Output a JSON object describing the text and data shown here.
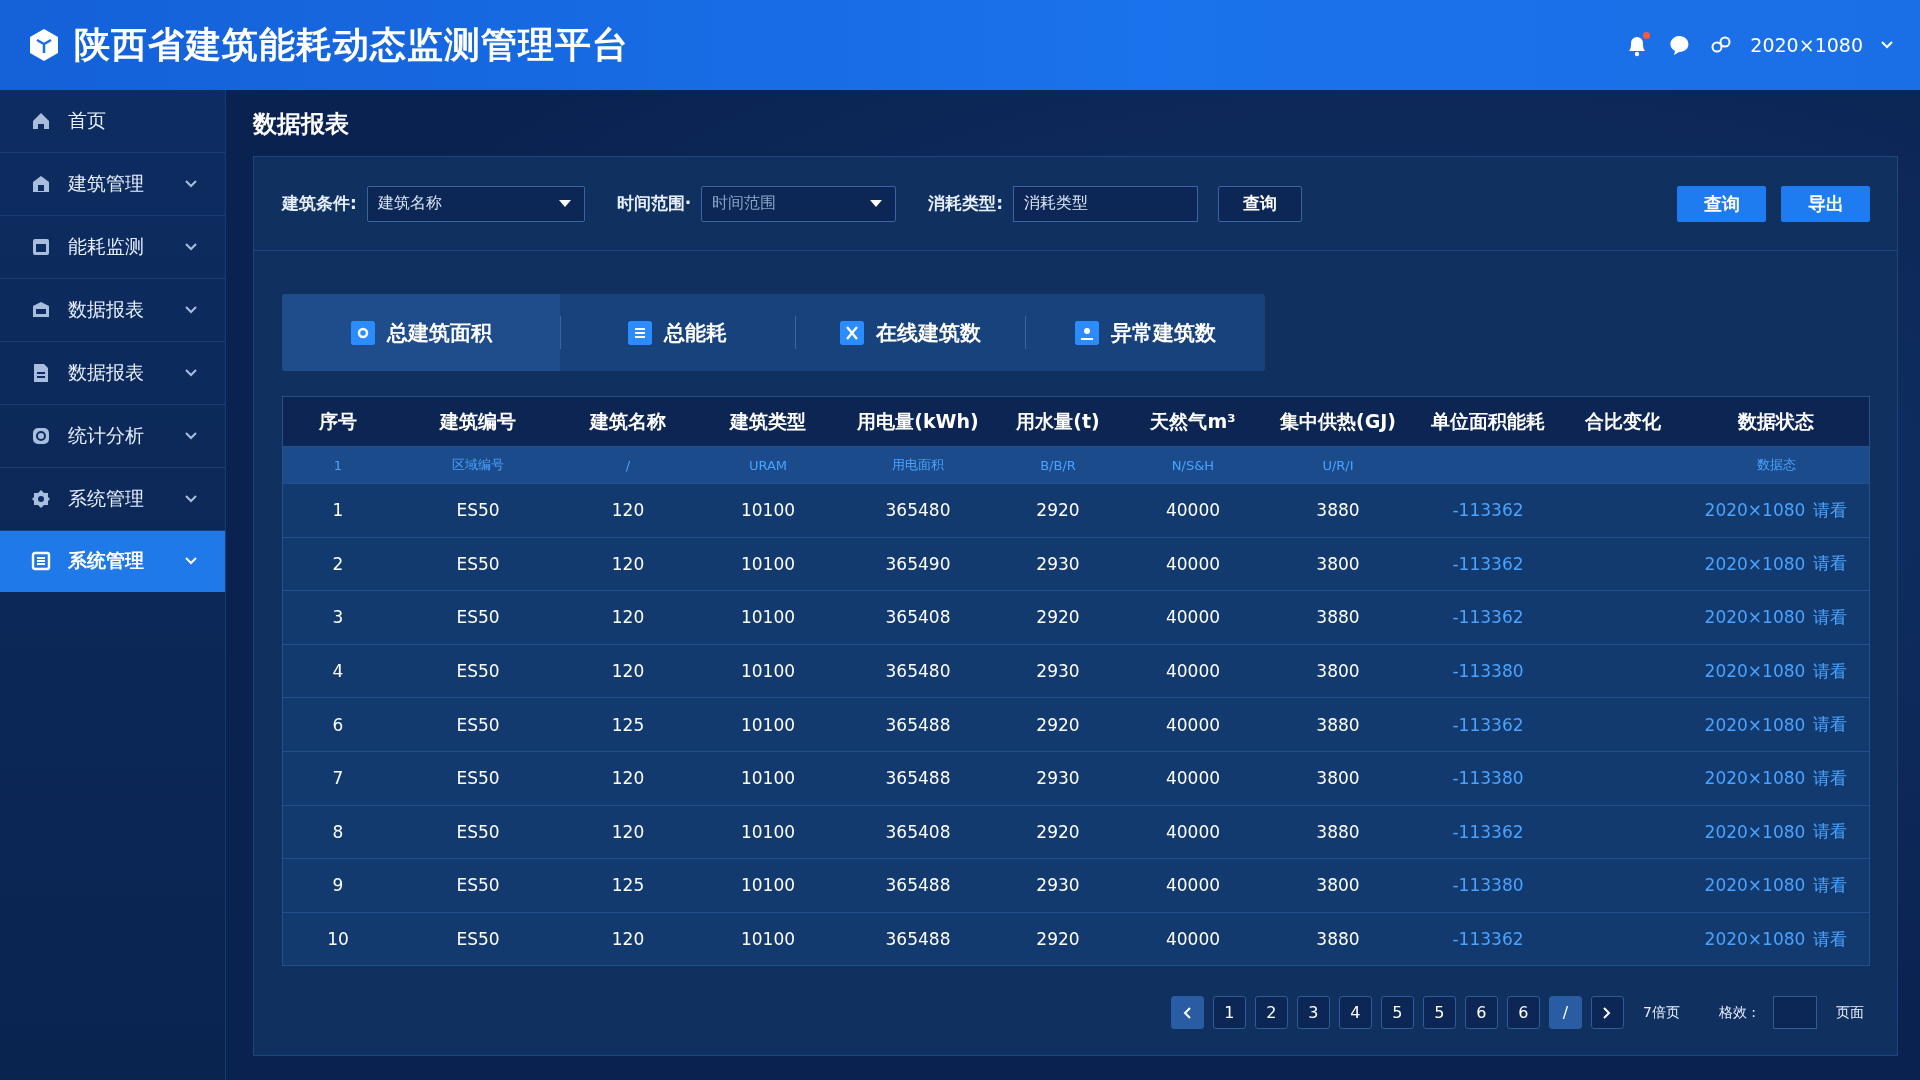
{
  "header": {
    "title": "陕西省建筑能耗动态监测管理平台",
    "resolution": "2020×1080",
    "notification": true
  },
  "sidebar": {
    "items": [
      {
        "label": "首页",
        "expandable": false,
        "selected": false
      },
      {
        "label": "建筑管理",
        "expandable": true,
        "selected": false
      },
      {
        "label": "能耗监测",
        "expandable": true,
        "selected": false
      },
      {
        "label": "数据报表",
        "expandable": true,
        "selected": false
      },
      {
        "label": "数据报表",
        "expandable": true,
        "selected": false
      },
      {
        "label": "统计分析",
        "expandable": true,
        "selected": false
      },
      {
        "label": "系统管理",
        "expandable": true,
        "selected": false
      },
      {
        "label": "系统管理",
        "expandable": true,
        "selected": true
      }
    ]
  },
  "page_title": "数据报表",
  "filters": [
    {
      "kind": "dropdown",
      "label": "建筑条件:",
      "value": "建筑名称"
    },
    {
      "kind": "dropdown",
      "label": "时间范围·",
      "placeholder": "时间范围"
    },
    {
      "kind": "text",
      "label": "消耗类型:",
      "value": "消耗类型"
    }
  ],
  "filter_button": "查询",
  "actions": [
    {
      "label": "查询"
    },
    {
      "label": "导出"
    }
  ],
  "stat_tabs": [
    {
      "label": "总建筑面积",
      "selected": true
    },
    {
      "label": "总能耗",
      "selected": false
    },
    {
      "label": "在线建筑数",
      "selected": false
    },
    {
      "label": "异常建筑数",
      "selected": false
    }
  ],
  "table": {
    "columns": [
      "序号",
      "建筑编号",
      "建筑名称",
      "建筑类型",
      "用电量(kWh)",
      "用水量(t)",
      "天然气m³",
      "集中供热(GJ)",
      "单位面积能耗",
      "合比变化",
      "数据状态"
    ],
    "subheader": {
      "cells": [
        "1",
        "区域编号",
        "/",
        "URAM",
        "用电面积",
        "B/B/R",
        "N/S&H",
        "U/R/I"
      ],
      "status": "数据态"
    },
    "rows": [
      {
        "cells": [
          "1",
          "ES50",
          "120",
          "10100",
          "365480",
          "2920",
          "40000",
          "3880",
          "-113362"
        ],
        "status": "2020×1080",
        "action": "请看"
      },
      {
        "cells": [
          "2",
          "ES50",
          "120",
          "10100",
          "365490",
          "2930",
          "40000",
          "3800",
          "-113362"
        ],
        "status": "2020×1080",
        "action": "请看"
      },
      {
        "cells": [
          "3",
          "ES50",
          "120",
          "10100",
          "365408",
          "2920",
          "40000",
          "3880",
          "-113362"
        ],
        "status": "2020×1080",
        "action": "请看"
      },
      {
        "cells": [
          "4",
          "ES50",
          "120",
          "10100",
          "365480",
          "2930",
          "40000",
          "3800",
          "-113380"
        ],
        "status": "2020×1080",
        "action": "请看"
      },
      {
        "cells": [
          "6",
          "ES50",
          "125",
          "10100",
          "365488",
          "2920",
          "40000",
          "3880",
          "-113362"
        ],
        "status": "2020×1080",
        "action": "请看"
      },
      {
        "cells": [
          "7",
          "ES50",
          "120",
          "10100",
          "365488",
          "2930",
          "40000",
          "3800",
          "-113380"
        ],
        "status": "2020×1080",
        "action": "请看"
      },
      {
        "cells": [
          "8",
          "ES50",
          "120",
          "10100",
          "365408",
          "2920",
          "40000",
          "3880",
          "-113362"
        ],
        "status": "2020×1080",
        "action": "请看"
      },
      {
        "cells": [
          "9",
          "ES50",
          "125",
          "10100",
          "365488",
          "2930",
          "40000",
          "3800",
          "-113380"
        ],
        "status": "2020×1080",
        "action": "请看"
      },
      {
        "cells": [
          "10",
          "ES50",
          "120",
          "10100",
          "365488",
          "2920",
          "40000",
          "3880",
          "-113362"
        ],
        "status": "2020×1080",
        "action": "请看"
      }
    ]
  },
  "pagination": {
    "pages": [
      {
        "label": "1",
        "selected": false
      },
      {
        "label": "2",
        "selected": false
      },
      {
        "label": "3",
        "selected": false
      },
      {
        "label": "4",
        "selected": false
      },
      {
        "label": "5",
        "selected": false
      },
      {
        "label": "5",
        "selected": false
      },
      {
        "label": "6",
        "selected": false
      },
      {
        "label": "6",
        "selected": false
      },
      {
        "label": "/",
        "selected": true
      }
    ],
    "total": "7倍页",
    "jump_label": "格效 :",
    "suffix": "页面"
  }
}
